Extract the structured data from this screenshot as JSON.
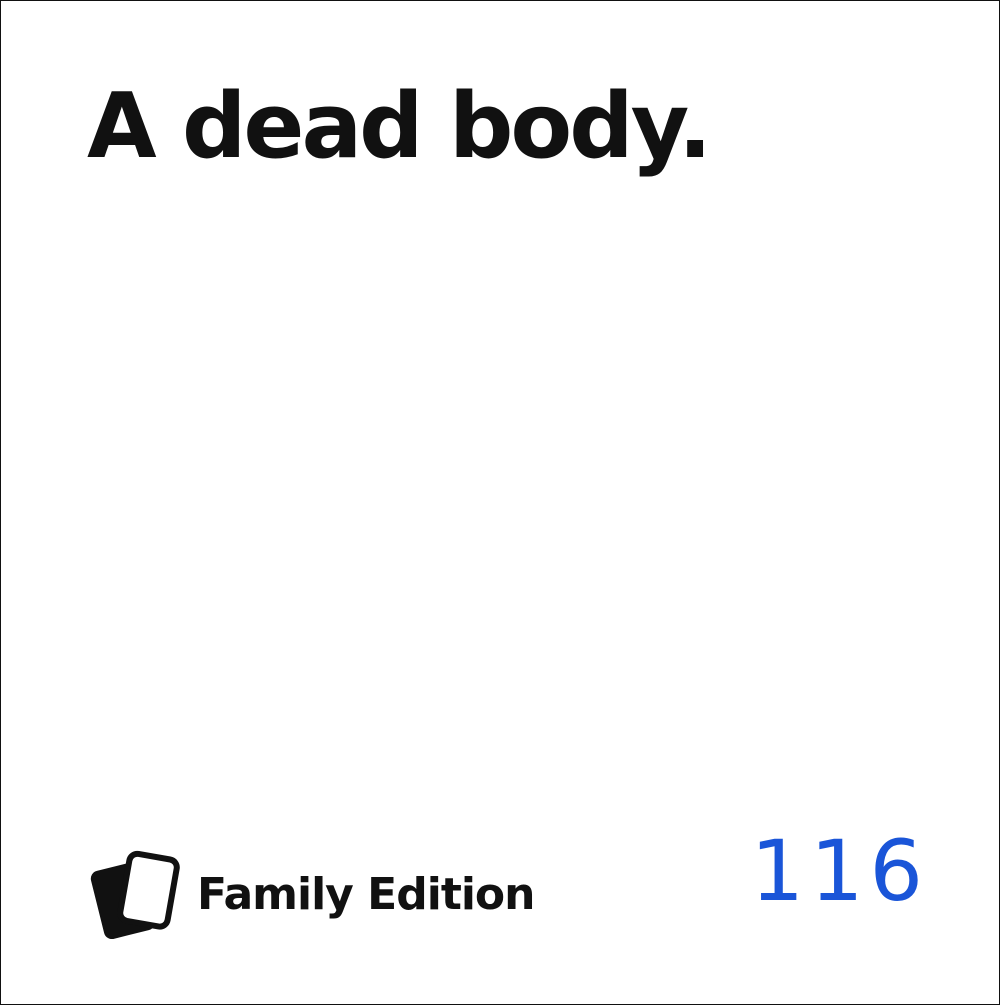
{
  "card": {
    "text": "A dead body.",
    "brand": "Family Edition",
    "brand_icon": "stacked-cards-icon",
    "number": "116",
    "text_color": "#111111",
    "number_color": "#1a55d8"
  }
}
